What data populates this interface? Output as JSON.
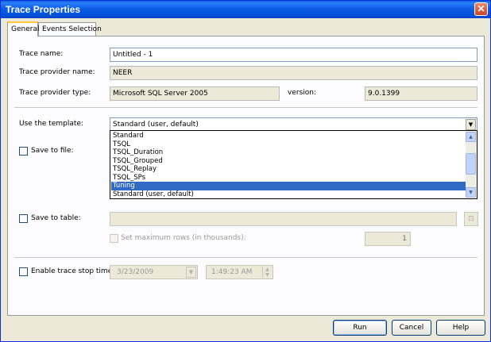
{
  "window": {
    "title": "Trace Properties",
    "close_glyph": "✕"
  },
  "tabs": [
    {
      "label": "General",
      "active": true
    },
    {
      "label": "Events Selection",
      "active": false
    }
  ],
  "general": {
    "trace_name_label": "Trace name:",
    "trace_name_value": "Untitled - 1",
    "provider_name_label": "Trace provider name:",
    "provider_name_value": "NEER",
    "provider_type_label": "Trace provider type:",
    "provider_type_value": "Microsoft SQL Server 2005",
    "version_label": "version:",
    "version_value": "9.0.1399",
    "template_label": "Use the template:",
    "template_value": "Standard (user, default)",
    "template_options": [
      "Standard",
      "TSQL",
      "TSQL_Duration",
      "TSQL_Grouped",
      "TSQL_Replay",
      "TSQL_SPs",
      "Tuning",
      "Standard (user, default)"
    ],
    "template_highlighted": "Tuning",
    "save_file_label": "Save to file:",
    "save_table_label": "Save to table:",
    "max_rows_label": "Set maximum rows (in thousands):",
    "max_rows_value": "1",
    "stop_time_label": "Enable trace stop time:",
    "stop_date_value": "3/23/2009",
    "stop_time_value": "1:49:23 AM"
  },
  "buttons": {
    "run": "Run",
    "cancel": "Cancel",
    "help": "Help"
  },
  "icons": {
    "combo_arrow": "chevron-down-icon",
    "browse": "browse-icon",
    "spin": "spinner-icon"
  },
  "colors": {
    "titlebar": "#0a5fe0",
    "selection": "#316ac5",
    "panel_bg": "#fcfcfe",
    "dialog_bg": "#ece9d8"
  }
}
